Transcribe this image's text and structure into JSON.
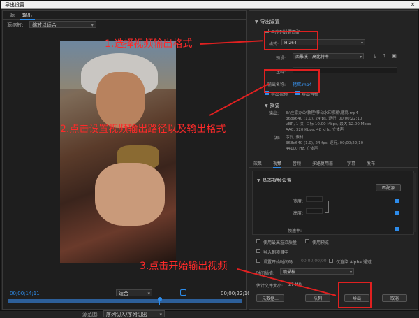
{
  "window": {
    "title": "导出设置",
    "close_icon": "×"
  },
  "source_panel": {
    "tabs": [
      "源",
      "输出"
    ],
    "active_tab": "输出",
    "scaling_label": "源缩放:",
    "scaling_value": "缩放以适合",
    "time_start": "00;00;14;11",
    "time_end": "00;00;22;10",
    "fit_value": "适合",
    "range_label": "源范围:",
    "range_value": "序列切入/序列切出"
  },
  "annotations": {
    "step1": "1.选择视频输出格式",
    "step2": "2.点击设置视频输出路径以及输出格式",
    "step3": "3.点击开始输出视频",
    "color": "#ff2a2a"
  },
  "export_settings": {
    "section_title": "导出设置",
    "match_sequence_label": "与序列设置匹配",
    "format_label": "格式:",
    "format_value": "H.264",
    "preset_label": "预设:",
    "preset_value": "西雕溪 - 高比特率",
    "comment_label": "注释:",
    "output_name_label": "输出名称:",
    "output_name_value": "猪窝.mp4",
    "export_video_label": "导出视频",
    "export_audio_label": "导出音频",
    "summary_title": "摘要",
    "output_label": "输出:",
    "output_lines": [
      "E:\\庄家办公\\教程\\移动水印模糊\\猪窝.mp4",
      "368x640 (1.0), 24fps, 逐行, 00;00;22;10",
      "VBR, 1 次, 目标 10.00 Mbps, 最大 12.00 Mbps",
      "AAC, 320 Kbps, 48 kHz, 立体声"
    ],
    "source_label": "源:",
    "source_lines": [
      "序列, 素材",
      "368x640 (1.0), 24 fps, 逐行, 00;00;22;10",
      "44100 Hz, 立体声"
    ]
  },
  "tabs": [
    "效果",
    "视频",
    "音频",
    "多路复用器",
    "字幕",
    "发布"
  ],
  "active_tab": "视频",
  "video_settings": {
    "title": "基本视频设置",
    "match_source_button": "匹配源",
    "width_label": "宽度:",
    "height_label": "高度:",
    "framerate_label": "帧速率:"
  },
  "options": {
    "max_render_quality": "使用最高渲染质量",
    "use_preview": "使用预览",
    "import_to_project": "导入到项目中",
    "set_start_timecode": "设置开始时间码",
    "timecode_value": "00;00;00;00",
    "render_alpha_only": "仅渲染 Alpha 通道",
    "time_interpolation_label": "时间插值:",
    "time_interpolation_value": "帧采样",
    "file_size_label": "估计文件大小:",
    "file_size_value": "27 MB"
  },
  "buttons": {
    "metadata": "元数据...",
    "queue": "队列",
    "export": "导出",
    "cancel": "取消"
  }
}
